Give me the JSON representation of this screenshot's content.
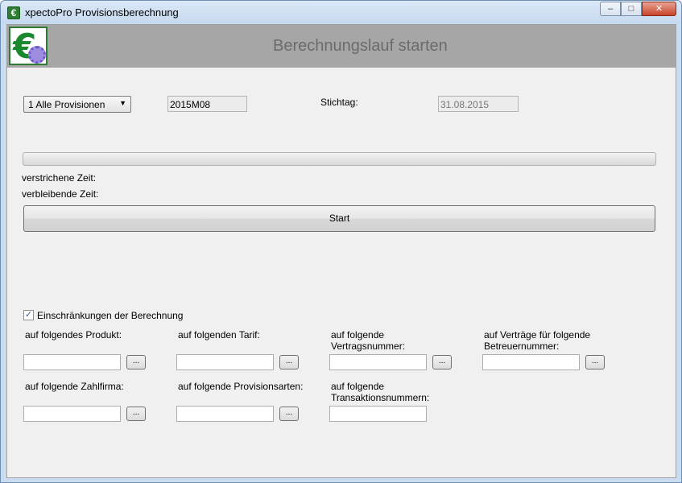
{
  "window": {
    "title": "xpectoPro Provisionsberechnung",
    "icon": "euro-app-icon"
  },
  "banner": {
    "title": "Berechnungslauf starten"
  },
  "controls": {
    "provision_select": "1 Alle Provisionen",
    "period_value": "2015M08",
    "stichtag_label": "Stichtag:",
    "stichtag_value": "31.08.2015"
  },
  "progress": {
    "value": 0,
    "elapsed_label": "verstrichene Zeit:",
    "remaining_label": "verbleibende Zeit:"
  },
  "start_button": "Start",
  "restrictions": {
    "checkbox_label": "Einschränkungen der Berechnung",
    "checked": true,
    "browse_label": "...",
    "fields": {
      "produkt": {
        "label": "auf folgendes Produkt:",
        "value": ""
      },
      "tarif": {
        "label": "auf folgenden Tarif:",
        "value": ""
      },
      "vertragsnummer": {
        "label_1": "auf folgende",
        "label_2": "Vertragsnummer:",
        "value": ""
      },
      "betreuernummer": {
        "label_1": "auf Verträge für folgende",
        "label_2": "Betreuernummer:",
        "value": ""
      },
      "zahlfirma": {
        "label": "auf folgende Zahlfirma:",
        "value": ""
      },
      "provisionsarten": {
        "label": "auf folgende Provisionsarten:",
        "value": ""
      },
      "transaktionsnummern": {
        "label_1": "auf folgende",
        "label_2": "Transaktionsnummern:",
        "value": ""
      }
    }
  }
}
